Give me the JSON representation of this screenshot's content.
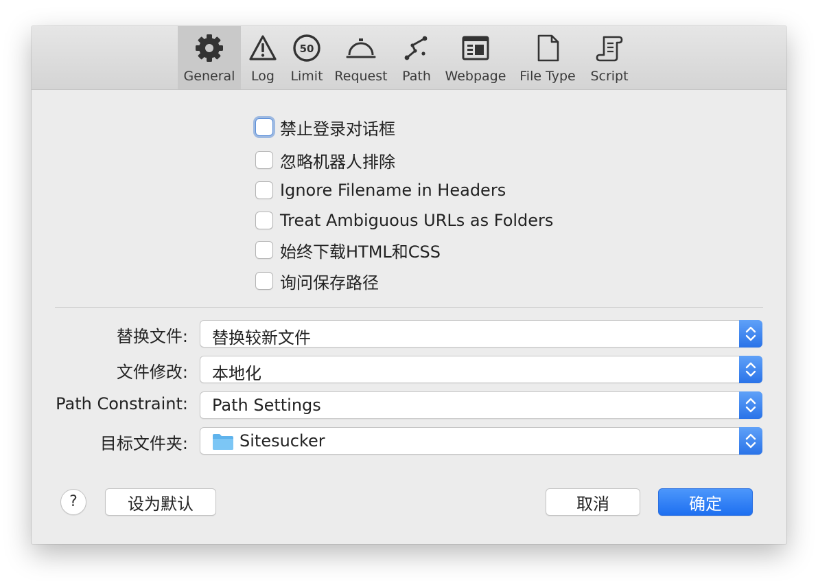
{
  "toolbar": {
    "tabs": [
      {
        "label": "General",
        "icon": "gear-icon"
      },
      {
        "label": "Log",
        "icon": "warning-icon"
      },
      {
        "label": "Limit",
        "icon": "limit-50-icon",
        "badge": "50"
      },
      {
        "label": "Request",
        "icon": "bell-icon"
      },
      {
        "label": "Path",
        "icon": "path-icon"
      },
      {
        "label": "Webpage",
        "icon": "webpage-icon"
      },
      {
        "label": "File Type",
        "icon": "document-icon"
      },
      {
        "label": "Script",
        "icon": "script-icon"
      }
    ],
    "selected": "General"
  },
  "options": [
    {
      "label": "禁止登录对话框",
      "checked": false,
      "focused": true
    },
    {
      "label": "忽略机器人排除",
      "checked": false
    },
    {
      "label": "Ignore Filename in Headers",
      "checked": false
    },
    {
      "label": "Treat Ambiguous URLs as Folders",
      "checked": false
    },
    {
      "label": "始终下载HTML和CSS",
      "checked": false
    },
    {
      "label": "询问保存路径",
      "checked": false
    }
  ],
  "form": {
    "replace_files": {
      "label": "替换文件:",
      "value": "替换较新文件"
    },
    "file_modification": {
      "label": "文件修改:",
      "value": "本地化"
    },
    "path_constraint": {
      "label": "Path Constraint:",
      "value": "Path Settings"
    },
    "destination": {
      "label": "目标文件夹:",
      "value": "Sitesucker",
      "icon": "folder-icon"
    }
  },
  "buttons": {
    "help": "?",
    "set_default": "设为默认",
    "cancel": "取消",
    "ok": "确定"
  },
  "colors": {
    "accent": "#2a73e8",
    "focus_ring": "#5c8fd8",
    "folder": "#5fb3ec"
  }
}
